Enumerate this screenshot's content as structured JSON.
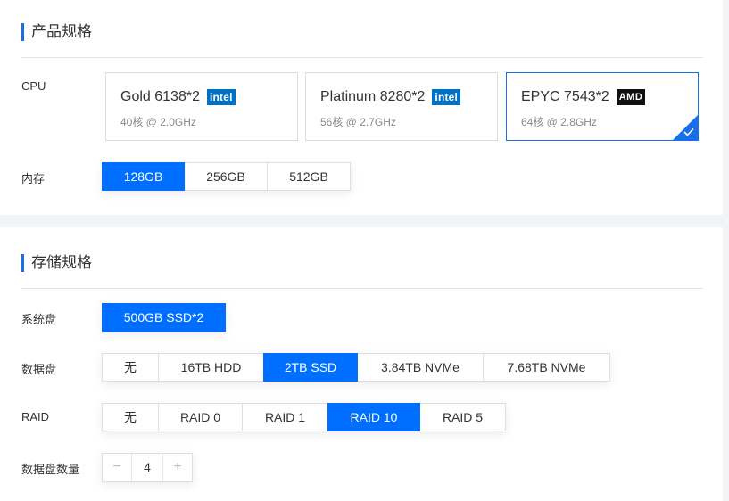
{
  "spec_section": {
    "title": "产品规格",
    "cpu_label": "CPU",
    "cpu_options": [
      {
        "name": "Gold 6138*2",
        "spec": "40核 @ 2.0GHz",
        "brand": "intel",
        "selected": false
      },
      {
        "name": "Platinum 8280*2",
        "spec": "56核 @ 2.7GHz",
        "brand": "intel",
        "selected": false
      },
      {
        "name": "EPYC 7543*2",
        "spec": "64核 @ 2.8GHz",
        "brand": "AMD",
        "selected": true
      }
    ],
    "memory_label": "内存",
    "memory_options": [
      "128GB",
      "256GB",
      "512GB"
    ],
    "memory_selected": "128GB"
  },
  "storage_section": {
    "title": "存储规格",
    "system_disk_label": "系统盘",
    "system_disk_options": [
      "500GB SSD*2"
    ],
    "system_disk_selected": "500GB SSD*2",
    "data_disk_label": "数据盘",
    "data_disk_options": [
      "无",
      "16TB HDD",
      "2TB SSD",
      "3.84TB NVMe",
      "7.68TB NVMe"
    ],
    "data_disk_selected": "2TB SSD",
    "raid_label": "RAID",
    "raid_options": [
      "无",
      "RAID 0",
      "RAID 1",
      "RAID 10",
      "RAID 5"
    ],
    "raid_selected": "RAID 10",
    "disk_count_label": "数据盘数量",
    "disk_count": "4",
    "decrement_symbol": "−",
    "increment_symbol": "+"
  },
  "colors": {
    "accent": "#006eff",
    "title_bar": "#1a6fe6",
    "intel": "#0071c5",
    "amd": "#111111"
  },
  "icons": {
    "check": "check-icon",
    "intel_logo": "intel-logo",
    "amd_logo": "amd-logo"
  }
}
